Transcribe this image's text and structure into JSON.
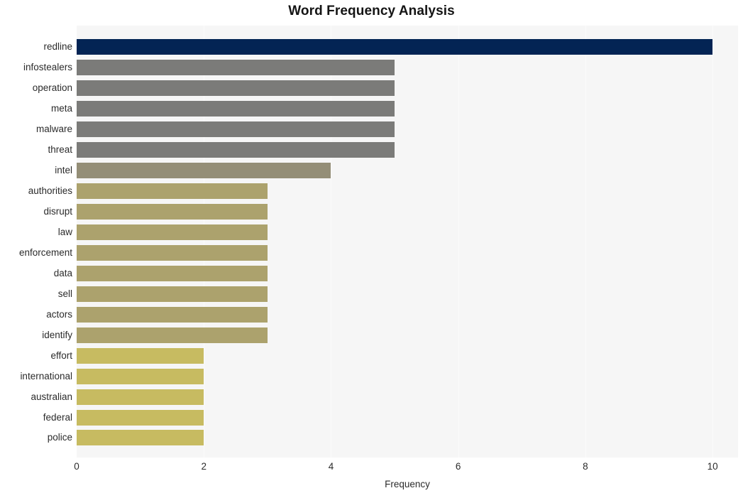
{
  "chart_data": {
    "type": "bar",
    "orientation": "horizontal",
    "title": "Word Frequency Analysis",
    "xlabel": "Frequency",
    "ylabel": "",
    "xlim": [
      0,
      10.4
    ],
    "xticks": [
      0,
      2,
      4,
      6,
      8,
      10
    ],
    "xtick_labels": [
      "0",
      "2",
      "4",
      "6",
      "8",
      "10"
    ],
    "grid": true,
    "grid_axis": "x",
    "legend": false,
    "categories": [
      "redline",
      "infostealers",
      "operation",
      "meta",
      "malware",
      "threat",
      "intel",
      "authorities",
      "disrupt",
      "law",
      "enforcement",
      "data",
      "sell",
      "actors",
      "identify",
      "effort",
      "international",
      "australian",
      "federal",
      "police"
    ],
    "values": [
      10,
      5,
      5,
      5,
      5,
      5,
      4,
      3,
      3,
      3,
      3,
      3,
      3,
      3,
      3,
      2,
      2,
      2,
      2,
      2
    ],
    "bar_colors": [
      "#032454",
      "#7b7b79",
      "#7b7b79",
      "#7b7b79",
      "#7b7b79",
      "#7b7b79",
      "#948e77",
      "#aca26d",
      "#aca26d",
      "#aca26d",
      "#aca26d",
      "#aca26d",
      "#aca26d",
      "#aca26d",
      "#aca26d",
      "#c7bb61",
      "#c7bb61",
      "#c7bb61",
      "#c7bb61",
      "#c7bb61"
    ]
  },
  "style": {
    "plot_background": "#f6f6f6",
    "page_background": "#ffffff",
    "gridline_color": "#fbfbfb",
    "text_color": "#2b2b2b",
    "title_color": "#151515"
  }
}
